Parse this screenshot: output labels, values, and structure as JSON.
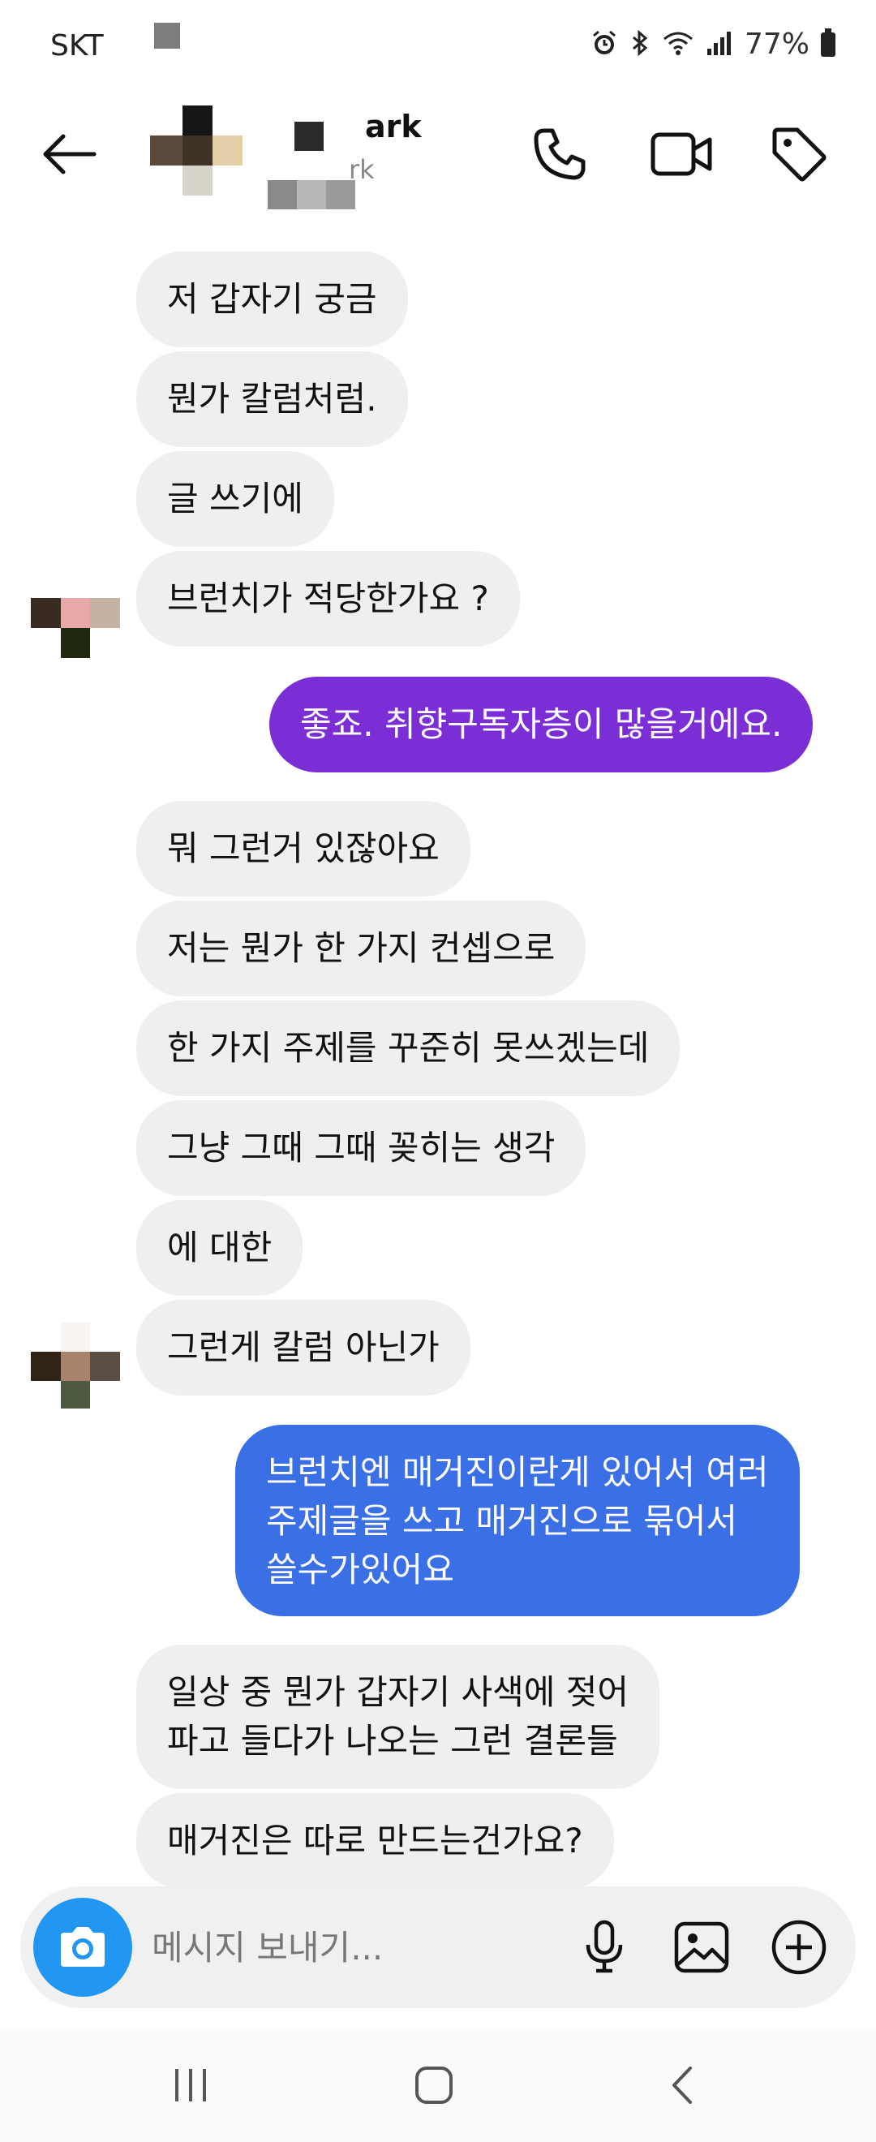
{
  "status_bar": {
    "carrier": "SKT",
    "battery_text": "77%",
    "icons": [
      "alarm-icon",
      "bluetooth-icon",
      "wifi-icon",
      "signal-icon",
      "battery-icon"
    ]
  },
  "header": {
    "contact_name": "ark",
    "contact_subtitle": "rk",
    "icons": [
      "back-arrow-icon",
      "phone-icon",
      "video-icon",
      "tag-icon"
    ]
  },
  "messages": [
    {
      "side": "in",
      "text": "저 갑자기 궁금"
    },
    {
      "side": "in",
      "text": "뭔가 칼럼처럼."
    },
    {
      "side": "in",
      "text": "글 쓰기에"
    },
    {
      "side": "in",
      "text": "브런치가 적당한가요 ?"
    },
    {
      "side": "out",
      "text": "좋죠. 취향구독자층이 많을거에요."
    },
    {
      "side": "in",
      "text": "뭐 그런거 있잖아요"
    },
    {
      "side": "in",
      "text": "저는 뭔가 한 가지 컨셉으로"
    },
    {
      "side": "in",
      "text": "한 가지 주제를 꾸준히 못쓰겠는데"
    },
    {
      "side": "in",
      "text": "그냥 그때 그때 꽂히는 생각"
    },
    {
      "side": "in",
      "text": "에 대한"
    },
    {
      "side": "in",
      "text": "그런게 칼럼 아닌가"
    },
    {
      "side": "out",
      "text": "브런치엔 매거진이란게 있어서 여러\n주제글을 쓰고 매거진으로 묶어서\n쓸수가있어요"
    },
    {
      "side": "in",
      "text": "일상 중 뭔가 갑자기 사색에 젖어\n파고 들다가 나오는 그런 결론들"
    },
    {
      "side": "in",
      "text": "매거진은 따로 만드는건가요?"
    }
  ],
  "composer": {
    "placeholder": "메시지 보내기...",
    "icons": [
      "camera-icon",
      "microphone-icon",
      "image-icon",
      "add-icon"
    ]
  },
  "nav_bar": {
    "icons": [
      "recent-apps-icon",
      "home-icon",
      "back-icon"
    ]
  },
  "colors": {
    "incoming_bubble": "#efefef",
    "outgoing_purple": "#7b2dd6",
    "outgoing_blue": "#3b6fe6",
    "camera_button": "#2196f3"
  }
}
